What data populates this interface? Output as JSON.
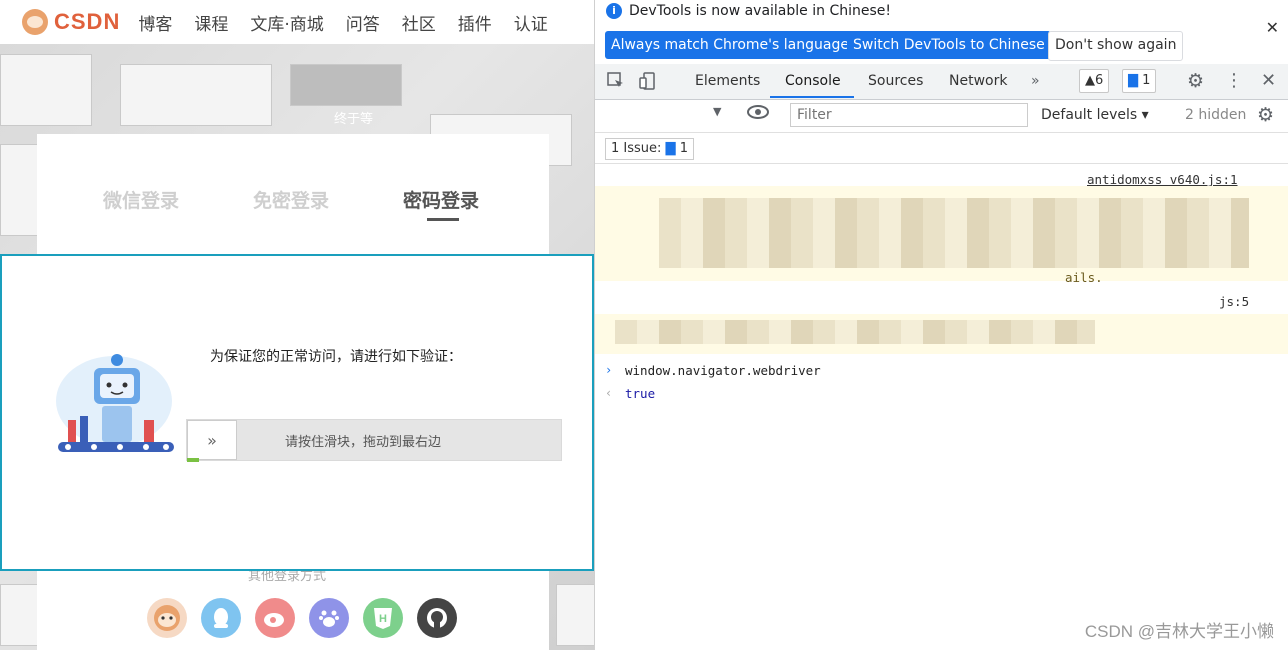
{
  "site": {
    "logo_text": "CSDN",
    "nav": [
      "博客",
      "课程",
      "文库·商城",
      "问答",
      "社区",
      "插件",
      "认证"
    ],
    "tip": "终于等",
    "login_tabs": [
      "微信登录",
      "免密登录",
      "密码登录"
    ],
    "other_login": "其他登录方式",
    "social_icons": [
      "avatar-icon",
      "qq-icon",
      "weibo-icon",
      "baidu-icon",
      "html5-icon",
      "github-icon"
    ]
  },
  "captcha": {
    "title": "为保证您的正常访问，请进行如下验证：",
    "slider_text": "请按住滑块，拖动到最右边",
    "knob_glyph": "»"
  },
  "devtools": {
    "info_text": "DevTools is now available in Chinese!",
    "btn_match": "Always match Chrome's language",
    "btn_switch": "Switch DevTools to Chinese",
    "btn_dont_show": "Don't show again",
    "tabs": [
      "Elements",
      "Console",
      "Sources",
      "Network"
    ],
    "active_tab": "Console",
    "warnings_badge": "6",
    "messages_badge": "1",
    "filter_placeholder": "Filter",
    "levels": "Default levels",
    "hidden": "2 hidden",
    "issue_pill": "1 Issue:",
    "issue_count": "1",
    "log_source_1": "antidomxss_v640.js:1",
    "log_source_2": "js:5",
    "log_tail_1": "ails.",
    "command": "window.navigator.webdriver",
    "result": "true",
    "colors": {
      "accent": "#1a73e8",
      "warning_bg": "#fffbe5"
    }
  },
  "watermark": "CSDN @吉林大学王小懒"
}
